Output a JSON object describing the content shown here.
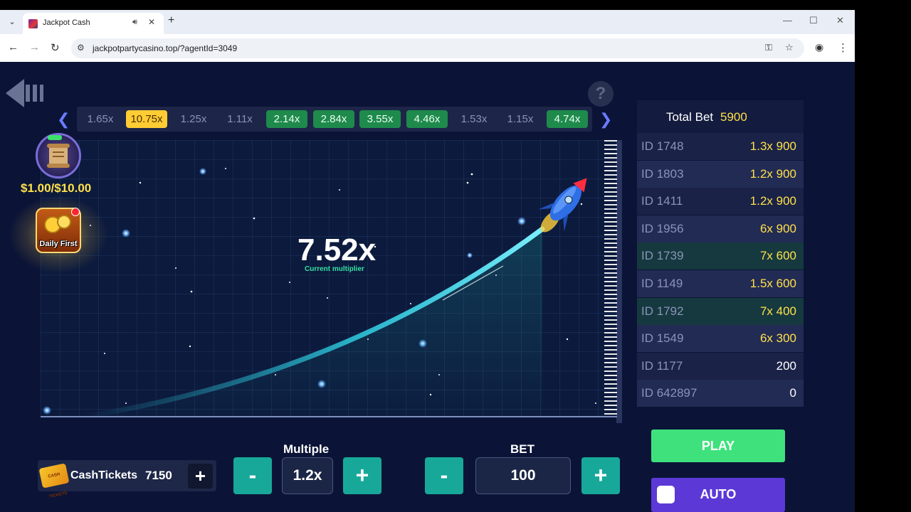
{
  "browser": {
    "tab_title": "Jackpot Cash",
    "url": "jackpotpartycasino.top/?agentId=3049",
    "tab_menu_icon": "chevron-down-icon",
    "new_tab_glyph": "+",
    "minimize_glyph": "—",
    "maximize_glyph": "☐",
    "close_glyph": "✕",
    "back_glyph": "←",
    "forward_glyph": "→",
    "reload_glyph": "↻"
  },
  "game": {
    "history": [
      {
        "value": "1.65x",
        "style": "plain"
      },
      {
        "value": "10.75x",
        "style": "gold"
      },
      {
        "value": "1.25x",
        "style": "plain"
      },
      {
        "value": "1.11x",
        "style": "plain"
      },
      {
        "value": "2.14x",
        "style": "green"
      },
      {
        "value": "2.84x",
        "style": "green"
      },
      {
        "value": "3.55x",
        "style": "green"
      },
      {
        "value": "4.46x",
        "style": "green"
      },
      {
        "value": "1.53x",
        "style": "plain"
      },
      {
        "value": "1.15x",
        "style": "plain"
      },
      {
        "value": "4.74x",
        "style": "green"
      }
    ],
    "current_multiplier": "7.52x",
    "current_multiplier_label": "Current multiplier",
    "help_glyph": "?",
    "quest_value": "$1.00/$10.00",
    "daily_label": "Daily First",
    "colors": {
      "background": "#0b1437",
      "trail": "#2fd6e8",
      "gold": "#ffcc33",
      "green": "#1e8a4c"
    }
  },
  "panel": {
    "total_bet_label": "Total Bet",
    "total_bet_value": "5900",
    "rows": [
      {
        "id": "ID 1748",
        "value": "1.3x 900",
        "highlight": "none",
        "value_color": "#ffe04a"
      },
      {
        "id": "ID 1803",
        "value": "1.2x 900",
        "highlight": "none",
        "value_color": "#ffe04a"
      },
      {
        "id": "ID 1411",
        "value": "1.2x 900",
        "highlight": "none",
        "value_color": "#ffe04a"
      },
      {
        "id": "ID 1956",
        "value": "6x 900",
        "highlight": "none",
        "value_color": "#ffe04a"
      },
      {
        "id": "ID 1739",
        "value": "7x 600",
        "highlight": "green",
        "value_color": "#ffe04a"
      },
      {
        "id": "ID 1149",
        "value": "1.5x 600",
        "highlight": "none",
        "value_color": "#ffe04a"
      },
      {
        "id": "ID 1792",
        "value": "7x 400",
        "highlight": "green",
        "value_color": "#ffe04a"
      },
      {
        "id": "ID 1549",
        "value": "6x 300",
        "highlight": "none",
        "value_color": "#ffe04a"
      },
      {
        "id": "ID 1177",
        "value": "200",
        "highlight": "none",
        "value_color": "#ffffff"
      },
      {
        "id": "ID 642897",
        "value": "0",
        "highlight": "none",
        "value_color": "#ffffff"
      }
    ]
  },
  "controls": {
    "cash_tickets_label": "CashTickets",
    "cash_tickets_icon_text": "CASH TICKETS",
    "cash_tickets_count": "7150",
    "plus_glyph": "+",
    "minus_glyph": "-",
    "multiple_label": "Multiple",
    "multiple_value": "1.2x",
    "bet_label": "BET",
    "bet_value": "100",
    "play_label": "PLAY",
    "auto_label": "AUTO"
  }
}
